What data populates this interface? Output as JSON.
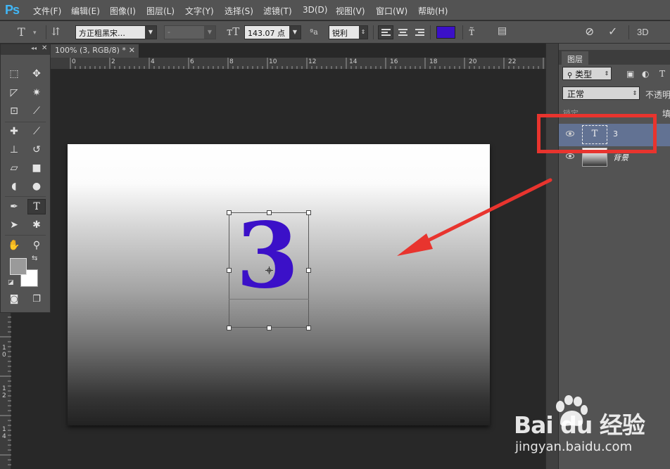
{
  "app": {
    "logo": "Ps"
  },
  "menu": [
    "文件(F)",
    "编辑(E)",
    "图像(I)",
    "图层(L)",
    "文字(Y)",
    "选择(S)",
    "滤镜(T)",
    "3D(D)",
    "视图(V)",
    "窗口(W)",
    "帮助(H)"
  ],
  "options": {
    "font_family": "方正粗黑宋…",
    "font_style": "-",
    "font_size": "143.07 点",
    "aa_glyph": "ªa",
    "antialias": "锐利",
    "text_color": "#3b10c8",
    "three_d": "3D"
  },
  "document": {
    "tab_title": "100% (3, RGB/8) *",
    "ruler_top": [
      "0",
      "2",
      "4",
      "6",
      "8",
      "10",
      "12",
      "14",
      "16",
      "18",
      "20",
      "22"
    ],
    "ruler_left": [
      "1",
      "0",
      "1",
      "2",
      "1",
      "4"
    ],
    "canvas_text": "3"
  },
  "toolbox": {
    "tools": [
      {
        "name": "rect-marquee",
        "glyph": "⬚"
      },
      {
        "name": "move",
        "glyph": "✥"
      },
      {
        "name": "lasso",
        "glyph": "◸"
      },
      {
        "name": "magic-wand",
        "glyph": "✷"
      },
      {
        "name": "crop",
        "glyph": "⊡"
      },
      {
        "name": "eyedropper",
        "glyph": "⟋"
      },
      {
        "name": "healing",
        "glyph": "✚"
      },
      {
        "name": "brush",
        "glyph": "⟋"
      },
      {
        "name": "clone-stamp",
        "glyph": "⊥"
      },
      {
        "name": "history-brush",
        "glyph": "↺"
      },
      {
        "name": "eraser",
        "glyph": "▱"
      },
      {
        "name": "gradient",
        "glyph": "■"
      },
      {
        "name": "blur",
        "glyph": "◖"
      },
      {
        "name": "dodge",
        "glyph": "●"
      },
      {
        "name": "pen",
        "glyph": "✒"
      },
      {
        "name": "type",
        "glyph": "T"
      },
      {
        "name": "path-select",
        "glyph": "➤"
      },
      {
        "name": "custom-shape",
        "glyph": "✱"
      },
      {
        "name": "hand",
        "glyph": "✋"
      },
      {
        "name": "zoom",
        "glyph": "⚲"
      }
    ],
    "fg_color": "#9a9a9a",
    "bg_color": "#ffffff"
  },
  "layers": {
    "tab": "图层",
    "filter": "类型",
    "blend_mode": "正常",
    "opacity_label": "不透明",
    "lock_label": "锁定",
    "fill_label": "填",
    "items": [
      {
        "name": "3",
        "thumb": "T",
        "selected": true
      },
      {
        "name": "背景",
        "thumb": "",
        "selected": false
      }
    ]
  },
  "watermark": {
    "logo": "Bai  du 经验",
    "url": "jingyan.baidu.com"
  }
}
